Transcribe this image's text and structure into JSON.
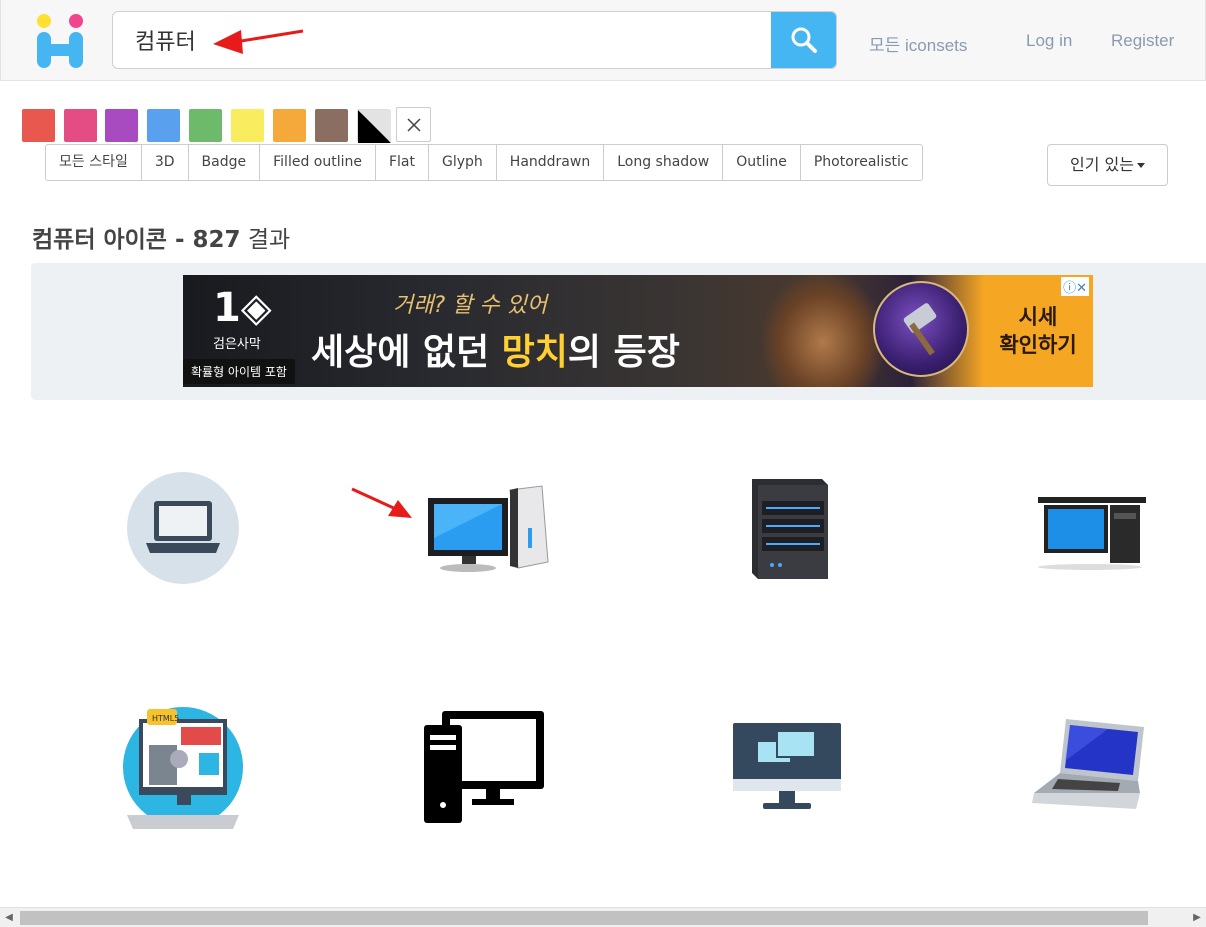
{
  "header": {
    "search_value": "컴퓨터",
    "search_placeholder": "",
    "links": {
      "iconsets": "모든 iconsets",
      "login": "Log in",
      "register": "Register"
    }
  },
  "colors": {
    "swatches": [
      "#e8584f",
      "#e44d84",
      "#a84ac0",
      "#59a0ef",
      "#6dbb6a",
      "#faec5f",
      "#f6a93b",
      "#8b6e62"
    ]
  },
  "styles": [
    "모든 스타일",
    "3D",
    "Badge",
    "Filled outline",
    "Flat",
    "Glyph",
    "Handdrawn",
    "Long shadow",
    "Outline",
    "Photorealistic"
  ],
  "sort": {
    "label": "인기 있는"
  },
  "results": {
    "query_bold": "컴퓨터 아이콘",
    "separator": " - ",
    "count": "827",
    "suffix": " 결과"
  },
  "ad": {
    "logo": "검은사막",
    "tag": "확률형 아이템 포함",
    "sub": "거래? 할 수 있어",
    "headline_pre": "세상에 없던 ",
    "headline_hl": "망치",
    "headline_post": "의 등장",
    "cta_line1": "시세",
    "cta_line2": "확인하기"
  },
  "icons": [
    "laptop-circle-icon",
    "desktop-computer-icon",
    "server-tower-icon",
    "compaq-desktop-icon",
    "web-development-computer-icon",
    "computer-glyph-icon",
    "desktop-monitor-windows-icon",
    "laptop-blue-icon"
  ]
}
